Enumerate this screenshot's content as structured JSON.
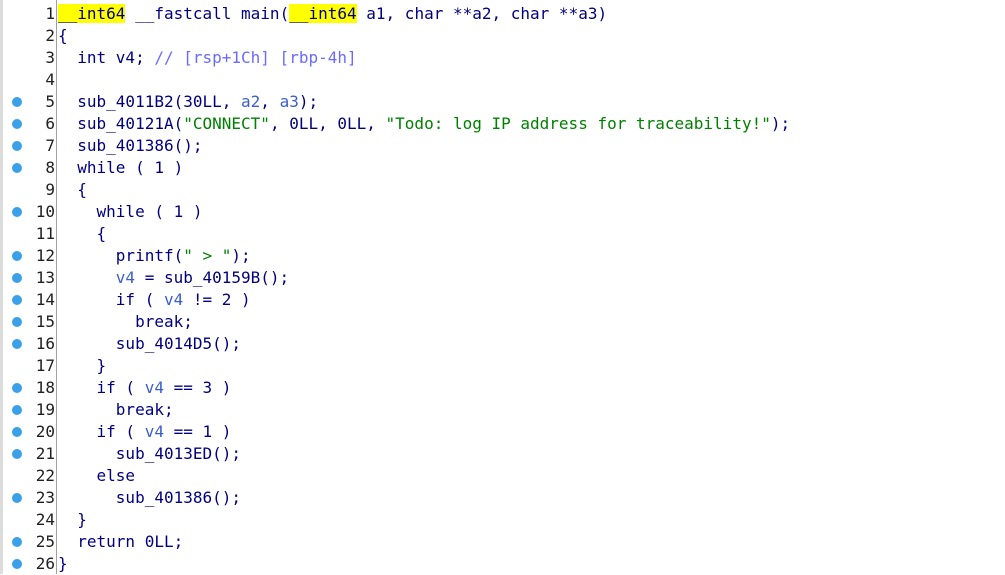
{
  "lines": [
    {
      "n": "1",
      "bp": false,
      "indent": "",
      "tokens": [
        {
          "t": "__int64",
          "c": "hl"
        },
        {
          "t": " __fastcall main(",
          "c": "plain"
        },
        {
          "t": "__int64",
          "c": "hl"
        },
        {
          "t": " a1, char **a2, char **a3)",
          "c": "plain"
        }
      ]
    },
    {
      "n": "2",
      "bp": false,
      "indent": "",
      "tokens": [
        {
          "t": "{",
          "c": "plain"
        }
      ]
    },
    {
      "n": "3",
      "bp": false,
      "indent": "  ",
      "tokens": [
        {
          "t": "int v4; ",
          "c": "plain"
        },
        {
          "t": "// [rsp+1Ch] [rbp-4h]",
          "c": "cmt"
        }
      ]
    },
    {
      "n": "4",
      "bp": false,
      "indent": "",
      "tokens": []
    },
    {
      "n": "5",
      "bp": true,
      "indent": "  ",
      "tokens": [
        {
          "t": "sub_4011B2(30LL, ",
          "c": "plain"
        },
        {
          "t": "a2",
          "c": "var"
        },
        {
          "t": ", ",
          "c": "plain"
        },
        {
          "t": "a3",
          "c": "var"
        },
        {
          "t": ");",
          "c": "plain"
        }
      ]
    },
    {
      "n": "6",
      "bp": true,
      "indent": "  ",
      "tokens": [
        {
          "t": "sub_40121A(",
          "c": "plain"
        },
        {
          "t": "\"CONNECT\"",
          "c": "str"
        },
        {
          "t": ", 0LL, 0LL, ",
          "c": "plain"
        },
        {
          "t": "\"Todo: log IP address for traceability!\"",
          "c": "str"
        },
        {
          "t": ");",
          "c": "plain"
        }
      ]
    },
    {
      "n": "7",
      "bp": true,
      "indent": "  ",
      "tokens": [
        {
          "t": "sub_401386();",
          "c": "plain"
        }
      ]
    },
    {
      "n": "8",
      "bp": true,
      "indent": "  ",
      "tokens": [
        {
          "t": "while ( 1 )",
          "c": "plain"
        }
      ]
    },
    {
      "n": "9",
      "bp": false,
      "indent": "  ",
      "tokens": [
        {
          "t": "{",
          "c": "plain"
        }
      ]
    },
    {
      "n": "10",
      "bp": true,
      "indent": "    ",
      "tokens": [
        {
          "t": "while ( 1 )",
          "c": "plain"
        }
      ]
    },
    {
      "n": "11",
      "bp": false,
      "indent": "    ",
      "tokens": [
        {
          "t": "{",
          "c": "plain"
        }
      ]
    },
    {
      "n": "12",
      "bp": true,
      "indent": "      ",
      "tokens": [
        {
          "t": "printf(",
          "c": "plain"
        },
        {
          "t": "\" > \"",
          "c": "str"
        },
        {
          "t": ");",
          "c": "plain"
        }
      ]
    },
    {
      "n": "13",
      "bp": true,
      "indent": "      ",
      "tokens": [
        {
          "t": "v4",
          "c": "var"
        },
        {
          "t": " = sub_40159B();",
          "c": "plain"
        }
      ]
    },
    {
      "n": "14",
      "bp": true,
      "indent": "      ",
      "tokens": [
        {
          "t": "if ( ",
          "c": "plain"
        },
        {
          "t": "v4",
          "c": "var"
        },
        {
          "t": " != 2 )",
          "c": "plain"
        }
      ]
    },
    {
      "n": "15",
      "bp": true,
      "indent": "        ",
      "tokens": [
        {
          "t": "break;",
          "c": "plain"
        }
      ]
    },
    {
      "n": "16",
      "bp": true,
      "indent": "      ",
      "tokens": [
        {
          "t": "sub_4014D5();",
          "c": "plain"
        }
      ]
    },
    {
      "n": "17",
      "bp": false,
      "indent": "    ",
      "tokens": [
        {
          "t": "}",
          "c": "plain"
        }
      ]
    },
    {
      "n": "18",
      "bp": true,
      "indent": "    ",
      "tokens": [
        {
          "t": "if ( ",
          "c": "plain"
        },
        {
          "t": "v4",
          "c": "var"
        },
        {
          "t": " == 3 )",
          "c": "plain"
        }
      ]
    },
    {
      "n": "19",
      "bp": true,
      "indent": "      ",
      "tokens": [
        {
          "t": "break;",
          "c": "plain"
        }
      ]
    },
    {
      "n": "20",
      "bp": true,
      "indent": "    ",
      "tokens": [
        {
          "t": "if ( ",
          "c": "plain"
        },
        {
          "t": "v4",
          "c": "var"
        },
        {
          "t": " == 1 )",
          "c": "plain"
        }
      ]
    },
    {
      "n": "21",
      "bp": true,
      "indent": "      ",
      "tokens": [
        {
          "t": "sub_4013ED();",
          "c": "plain"
        }
      ]
    },
    {
      "n": "22",
      "bp": false,
      "indent": "    ",
      "tokens": [
        {
          "t": "else",
          "c": "plain"
        }
      ]
    },
    {
      "n": "23",
      "bp": true,
      "indent": "      ",
      "tokens": [
        {
          "t": "sub_401386();",
          "c": "plain"
        }
      ]
    },
    {
      "n": "24",
      "bp": false,
      "indent": "  ",
      "tokens": [
        {
          "t": "}",
          "c": "plain"
        }
      ]
    },
    {
      "n": "25",
      "bp": true,
      "indent": "  ",
      "tokens": [
        {
          "t": "return 0LL;",
          "c": "plain"
        }
      ]
    },
    {
      "n": "26",
      "bp": true,
      "indent": "",
      "tokens": [
        {
          "t": "}",
          "c": "plain"
        }
      ]
    }
  ]
}
